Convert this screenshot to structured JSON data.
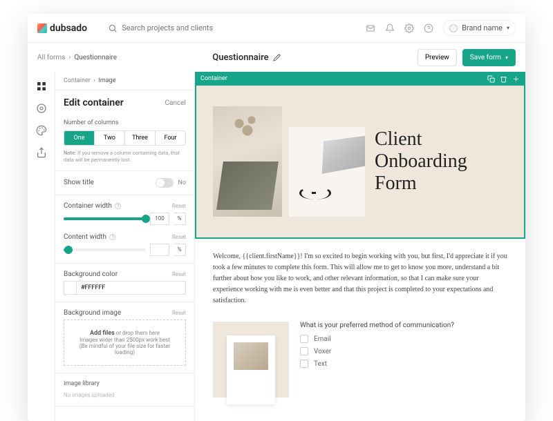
{
  "brand": "dubsado",
  "search_placeholder": "Search projects and clients",
  "brand_name": "Brand name",
  "crumbs": {
    "root": "All forms",
    "current": "Questionnaire"
  },
  "page_title": "Questionnaire",
  "preview_label": "Preview",
  "save_label": "Save form",
  "panel": {
    "crumb_root": "Container",
    "crumb_current": "Image",
    "title": "Edit container",
    "cancel": "Cancel",
    "cols_label": "Number of columns",
    "cols": [
      "One",
      "Two",
      "Three",
      "Four"
    ],
    "note_prefix": "Note:",
    "note": "If you remove a column containing data, that data will be permanently lost.",
    "show_title": "Show title",
    "toggle_off": "No",
    "container_width": "Container width",
    "content_width": "Content width",
    "reset": "Reset",
    "width_value": "100",
    "pct": "%",
    "bg_color_label": "Background color",
    "bg_color": "#FFFFFF",
    "bg_image_label": "Background image",
    "add_files": "Add files",
    "drop_hint": " or drop them here",
    "drop_sub1": "Images wider than 2500px work best",
    "drop_sub2": "(Be mindful of your file size for faster loading)",
    "image_library": "Image library",
    "no_images": "No images uploaded"
  },
  "canvas": {
    "container_label": "Container",
    "hero_title": "Client Onboarding Form",
    "welcome": "Welcome, {{client.firstName}}! I'm so excited to begin working with you, but first, I'd appreciate it if you took a few minutes to complete this form. This will allow me to get to know you more, understand a bit further about how you like to work, and other relevant information, so that I can make sure your experience working with me is even better and that this project is completed to your expectations and satisfaction.",
    "question": "What is your preferred method of communication?",
    "options": [
      "Email",
      "Voxer",
      "Text"
    ]
  }
}
